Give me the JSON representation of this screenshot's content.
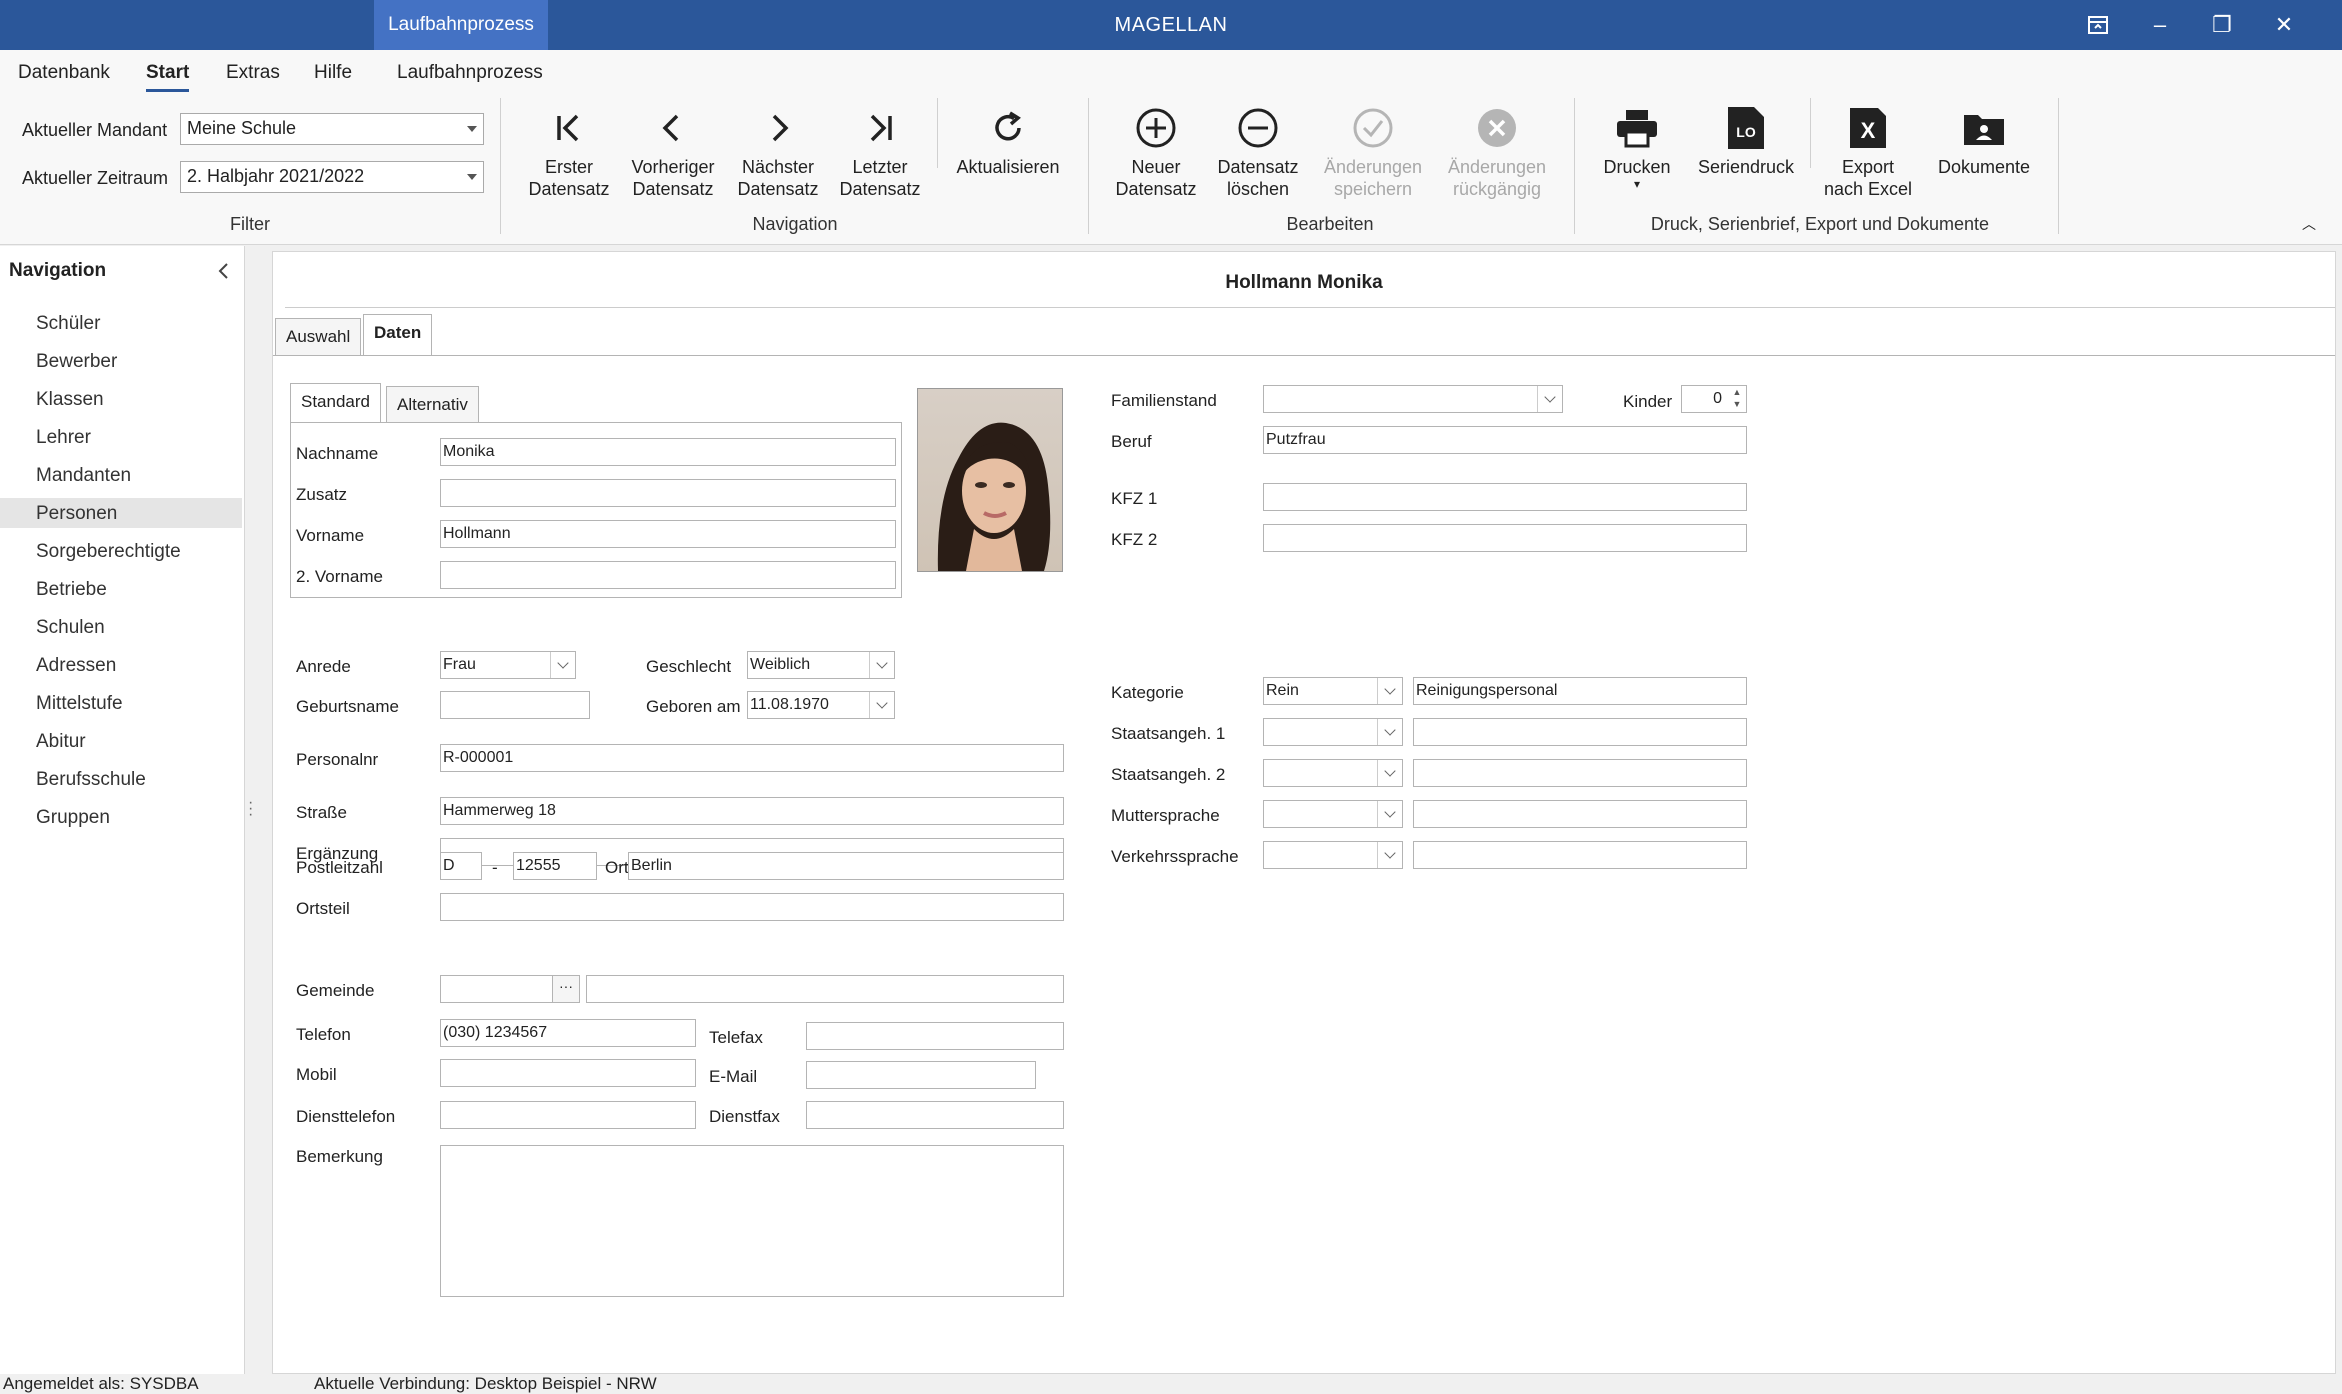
{
  "window": {
    "context_tab": "Laufbahnprozess",
    "title": "MAGELLAN",
    "buttons": {
      "restore_icon": "ribbon-display-icon",
      "minimize": "–",
      "maximize": "❐",
      "close": "✕"
    }
  },
  "menu": [
    "Datenbank",
    "Start",
    "Extras",
    "Hilfe",
    "Laufbahnprozess"
  ],
  "ribbon": {
    "filter": {
      "mandant_label": "Aktueller Mandant",
      "mandant_value": "Meine Schule",
      "zeitraum_label": "Aktueller Zeitraum",
      "zeitraum_value": "2. Halbjahr 2021/2022",
      "group_label": "Filter"
    },
    "navigation": {
      "first": [
        "Erster",
        "Datensatz"
      ],
      "prev": [
        "Vorheriger",
        "Datensatz"
      ],
      "next": [
        "Nächster",
        "Datensatz"
      ],
      "last": [
        "Letzter",
        "Datensatz"
      ],
      "refresh": "Aktualisieren",
      "group_label": "Navigation"
    },
    "bearbeiten": {
      "new": [
        "Neuer",
        "Datensatz"
      ],
      "delete": [
        "Datensatz",
        "löschen"
      ],
      "save": [
        "Änderungen",
        "speichern"
      ],
      "undo": [
        "Änderungen",
        "rückgängig"
      ],
      "group_label": "Bearbeiten"
    },
    "druck": {
      "print": "Drucken",
      "serial": "Seriendruck",
      "serial_icon_text": "LO",
      "excel": [
        "Export",
        "nach Excel"
      ],
      "excel_icon_text": "X",
      "docs": "Dokumente",
      "group_label": "Druck, Serienbrief, Export und Dokumente"
    }
  },
  "navigation": {
    "title": "Navigation",
    "items": [
      "Schüler",
      "Bewerber",
      "Klassen",
      "Lehrer",
      "Mandanten",
      "Personen",
      "Sorgeberechtigte",
      "Betriebe",
      "Schulen",
      "Adressen",
      "Mittelstufe",
      "Abitur",
      "Berufsschule",
      "Gruppen"
    ],
    "selected": "Personen"
  },
  "record": {
    "title": "Hollmann Monika",
    "tabs": [
      "Auswahl",
      "Daten"
    ],
    "subtabs": [
      "Standard",
      "Alternativ"
    ],
    "fields": {
      "nachname": {
        "label": "Nachname",
        "value": "Monika"
      },
      "zusatz": {
        "label": "Zusatz",
        "value": ""
      },
      "vorname": {
        "label": "Vorname",
        "value": "Hollmann"
      },
      "vorname2": {
        "label": "2. Vorname",
        "value": ""
      },
      "anrede": {
        "label": "Anrede",
        "value": "Frau"
      },
      "geschlecht": {
        "label": "Geschlecht",
        "value": "Weiblich"
      },
      "geburtsname": {
        "label": "Geburtsname",
        "value": ""
      },
      "geboren": {
        "label": "Geboren am",
        "value": "11.08.1970"
      },
      "personalnr": {
        "label": "Personalnr",
        "value": "R-000001"
      },
      "strasse": {
        "label": "Straße",
        "value": "Hammerweg 18"
      },
      "ergaenzung": {
        "label": "Ergänzung",
        "value": ""
      },
      "plz": {
        "label": "Postleitzahl",
        "country": "D",
        "dash": "-",
        "value": "12555"
      },
      "ort": {
        "label": "Ort",
        "value": "Berlin"
      },
      "ortsteil": {
        "label": "Ortsteil",
        "value": ""
      },
      "gemeinde": {
        "label": "Gemeinde",
        "value": "",
        "button": "···"
      },
      "telefon": {
        "label": "Telefon",
        "value": "(030) 1234567"
      },
      "telefax": {
        "label": "Telefax",
        "value": ""
      },
      "mobil": {
        "label": "Mobil",
        "value": ""
      },
      "email": {
        "label": "E-Mail",
        "value": ""
      },
      "diensttelefon": {
        "label": "Diensttelefon",
        "value": ""
      },
      "dienstfax": {
        "label": "Dienstfax",
        "value": ""
      },
      "bemerkung": {
        "label": "Bemerkung",
        "value": ""
      },
      "familienstand": {
        "label": "Familienstand",
        "value": ""
      },
      "kinder": {
        "label": "Kinder",
        "value": "0"
      },
      "beruf": {
        "label": "Beruf",
        "value": "Putzfrau"
      },
      "kfz1": {
        "label": "KFZ 1",
        "value": ""
      },
      "kfz2": {
        "label": "KFZ 2",
        "value": ""
      },
      "kategorie": {
        "label": "Kategorie",
        "code": "Rein",
        "value": "Reinigungspersonal"
      },
      "staat1": {
        "label": "Staatsangeh. 1",
        "code": "",
        "value": ""
      },
      "staat2": {
        "label": "Staatsangeh. 2",
        "code": "",
        "value": ""
      },
      "mutter": {
        "label": "Muttersprache",
        "code": "",
        "value": ""
      },
      "verkehr": {
        "label": "Verkehrssprache",
        "code": "",
        "value": ""
      }
    }
  },
  "status": {
    "user": "Angemeldet als: SYSDBA",
    "connection": "Aktuelle Verbindung: Desktop Beispiel - NRW"
  },
  "colors": {
    "titlebar": "#2b579a",
    "context_tab": "#4472c4"
  }
}
